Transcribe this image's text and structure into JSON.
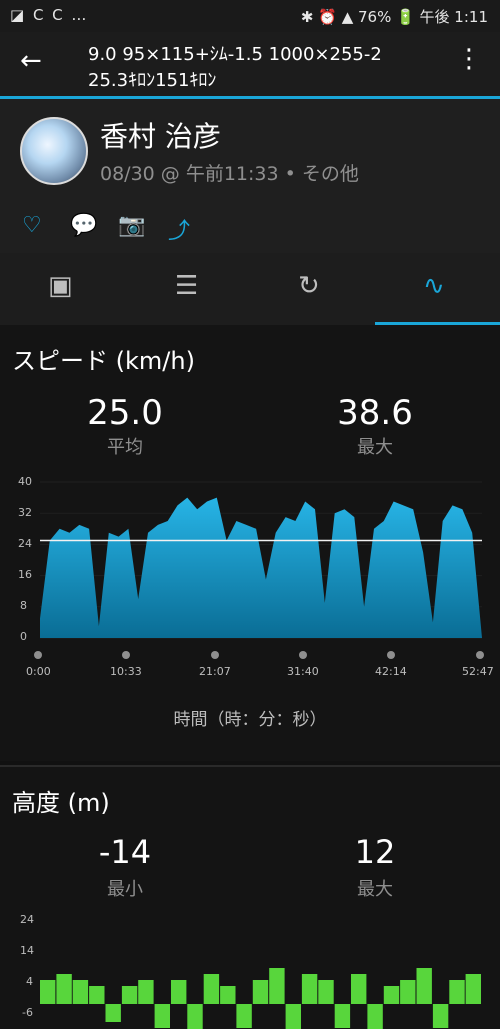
{
  "status": {
    "left": "◪ C C …",
    "right": "✱ ⏰ ▲ 76% 🔋 午後 1:11"
  },
  "header": {
    "title_line1": "9.0 95×115+ｼﾑ-1.5 1000×255-2",
    "title_line2": "25.3ｷﾛﾝ151ｷﾛﾝ"
  },
  "profile": {
    "name": "香村 治彦",
    "meta": "08/30 @ 午前11:33 • その他"
  },
  "actions": {
    "like": "♡",
    "comment": "💬",
    "camera": "📷",
    "share": "⤴"
  },
  "tabs": [
    {
      "label": "summary-icon"
    },
    {
      "label": "details-icon"
    },
    {
      "label": "laps-icon"
    },
    {
      "label": "charts-icon"
    }
  ],
  "speed": {
    "title": "スピード (km/h)",
    "avg": "25.0",
    "avg_label": "平均",
    "max": "38.6",
    "max_label": "最大",
    "x_caption": "時間（時：分：秒）",
    "y_ticks": [
      "40",
      "32",
      "24",
      "16",
      "8",
      "0"
    ],
    "x_ticks": [
      "0:00",
      "10:33",
      "21:07",
      "31:40",
      "42:14",
      "52:47"
    ]
  },
  "elevation": {
    "title": "高度 (m)",
    "min": "-14",
    "min_label": "最小",
    "max": "12",
    "max_label": "最大",
    "y_ticks": [
      "24",
      "14",
      "4",
      "-6"
    ]
  },
  "chart_data": [
    {
      "type": "area",
      "title": "スピード (km/h)",
      "xlabel": "時間（時：分：秒）",
      "ylabel": "",
      "ylim": [
        0,
        40
      ],
      "x_ticks": [
        "0:00",
        "10:33",
        "21:07",
        "31:40",
        "42:14",
        "52:47"
      ],
      "average_line": 25.0,
      "series": [
        {
          "values": [
            5,
            25,
            28,
            27,
            29,
            28,
            3,
            27,
            26,
            28,
            10,
            27,
            29,
            30,
            34,
            36,
            33,
            35,
            36,
            25,
            30,
            29,
            28,
            15,
            27,
            31,
            30,
            35,
            33,
            9,
            32,
            33,
            31,
            8,
            28,
            30,
            35,
            34,
            33,
            22,
            4,
            30,
            34,
            33,
            27,
            0
          ]
        }
      ]
    },
    {
      "type": "bar",
      "title": "高度 (m)",
      "ylim": [
        -6,
        24
      ],
      "series": [
        {
          "values": [
            4,
            5,
            4,
            3,
            -3,
            3,
            4,
            -4,
            4,
            -5,
            5,
            3,
            -4,
            4,
            6,
            -6,
            5,
            4,
            -4,
            5,
            -5,
            3,
            4,
            6,
            -4,
            4,
            5
          ]
        }
      ]
    }
  ]
}
